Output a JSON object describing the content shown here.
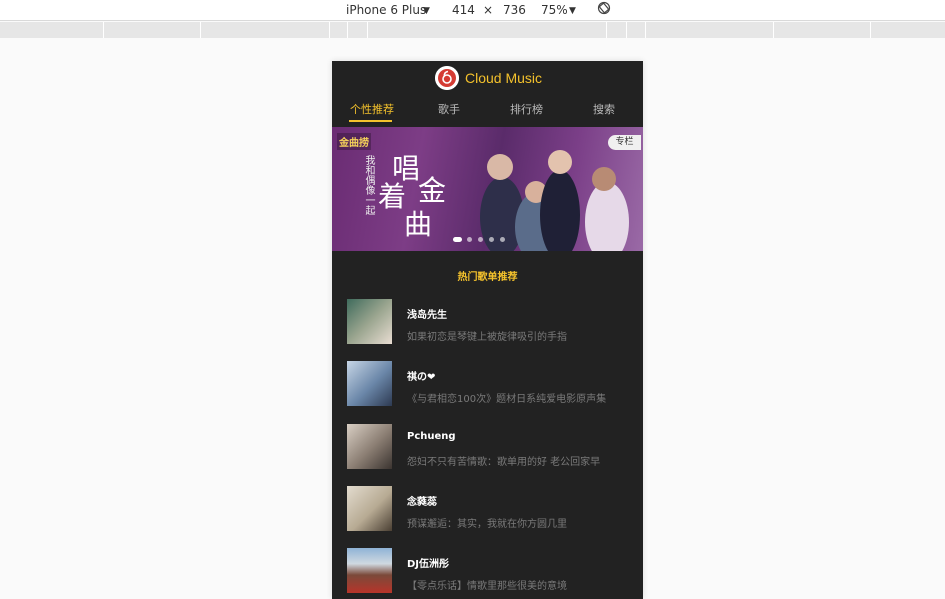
{
  "devtools": {
    "device": "iPhone 6 Plus",
    "width": "414",
    "times": "×",
    "height": "736",
    "zoom": "75%",
    "rotate_icon": "rotate-icon"
  },
  "app": {
    "name": "Cloud Music",
    "logo_icon": "netease-music-logo",
    "accent": "#f3c12c"
  },
  "tabs": [
    {
      "label": "个性推荐",
      "active": true
    },
    {
      "label": "歌手",
      "active": false
    },
    {
      "label": "排行榜",
      "active": false
    },
    {
      "label": "搜索",
      "active": false
    }
  ],
  "banner": {
    "tag": "金曲捞",
    "side_text": "我和偶像一起",
    "chars": [
      "唱",
      "着",
      "金",
      "曲"
    ],
    "badge": "专栏"
  },
  "section": {
    "title": "热门歌单推荐"
  },
  "playlists": [
    {
      "title": "浅岛先生",
      "desc": "如果初恋是琴键上被旋律吸引的手指",
      "cover": "#9aa58f"
    },
    {
      "title": "祺の❤",
      "desc": "《与君相恋100次》题材日系纯爱电影原声集",
      "cover": "#6a86a8"
    },
    {
      "title": "Pchueng",
      "desc": "怨妇不只有苦情歌：歌单用的好 老公回家早",
      "cover": "#8a7d72"
    },
    {
      "title": "念蕤蕊",
      "desc": "预谋邂逅：其实，我就在你方圆几里",
      "cover": "#b7aa93"
    },
    {
      "title": "DJ伍洲彤",
      "desc": "【零点乐话】情歌里那些很美的意境",
      "cover": "#7b4a3a"
    }
  ]
}
